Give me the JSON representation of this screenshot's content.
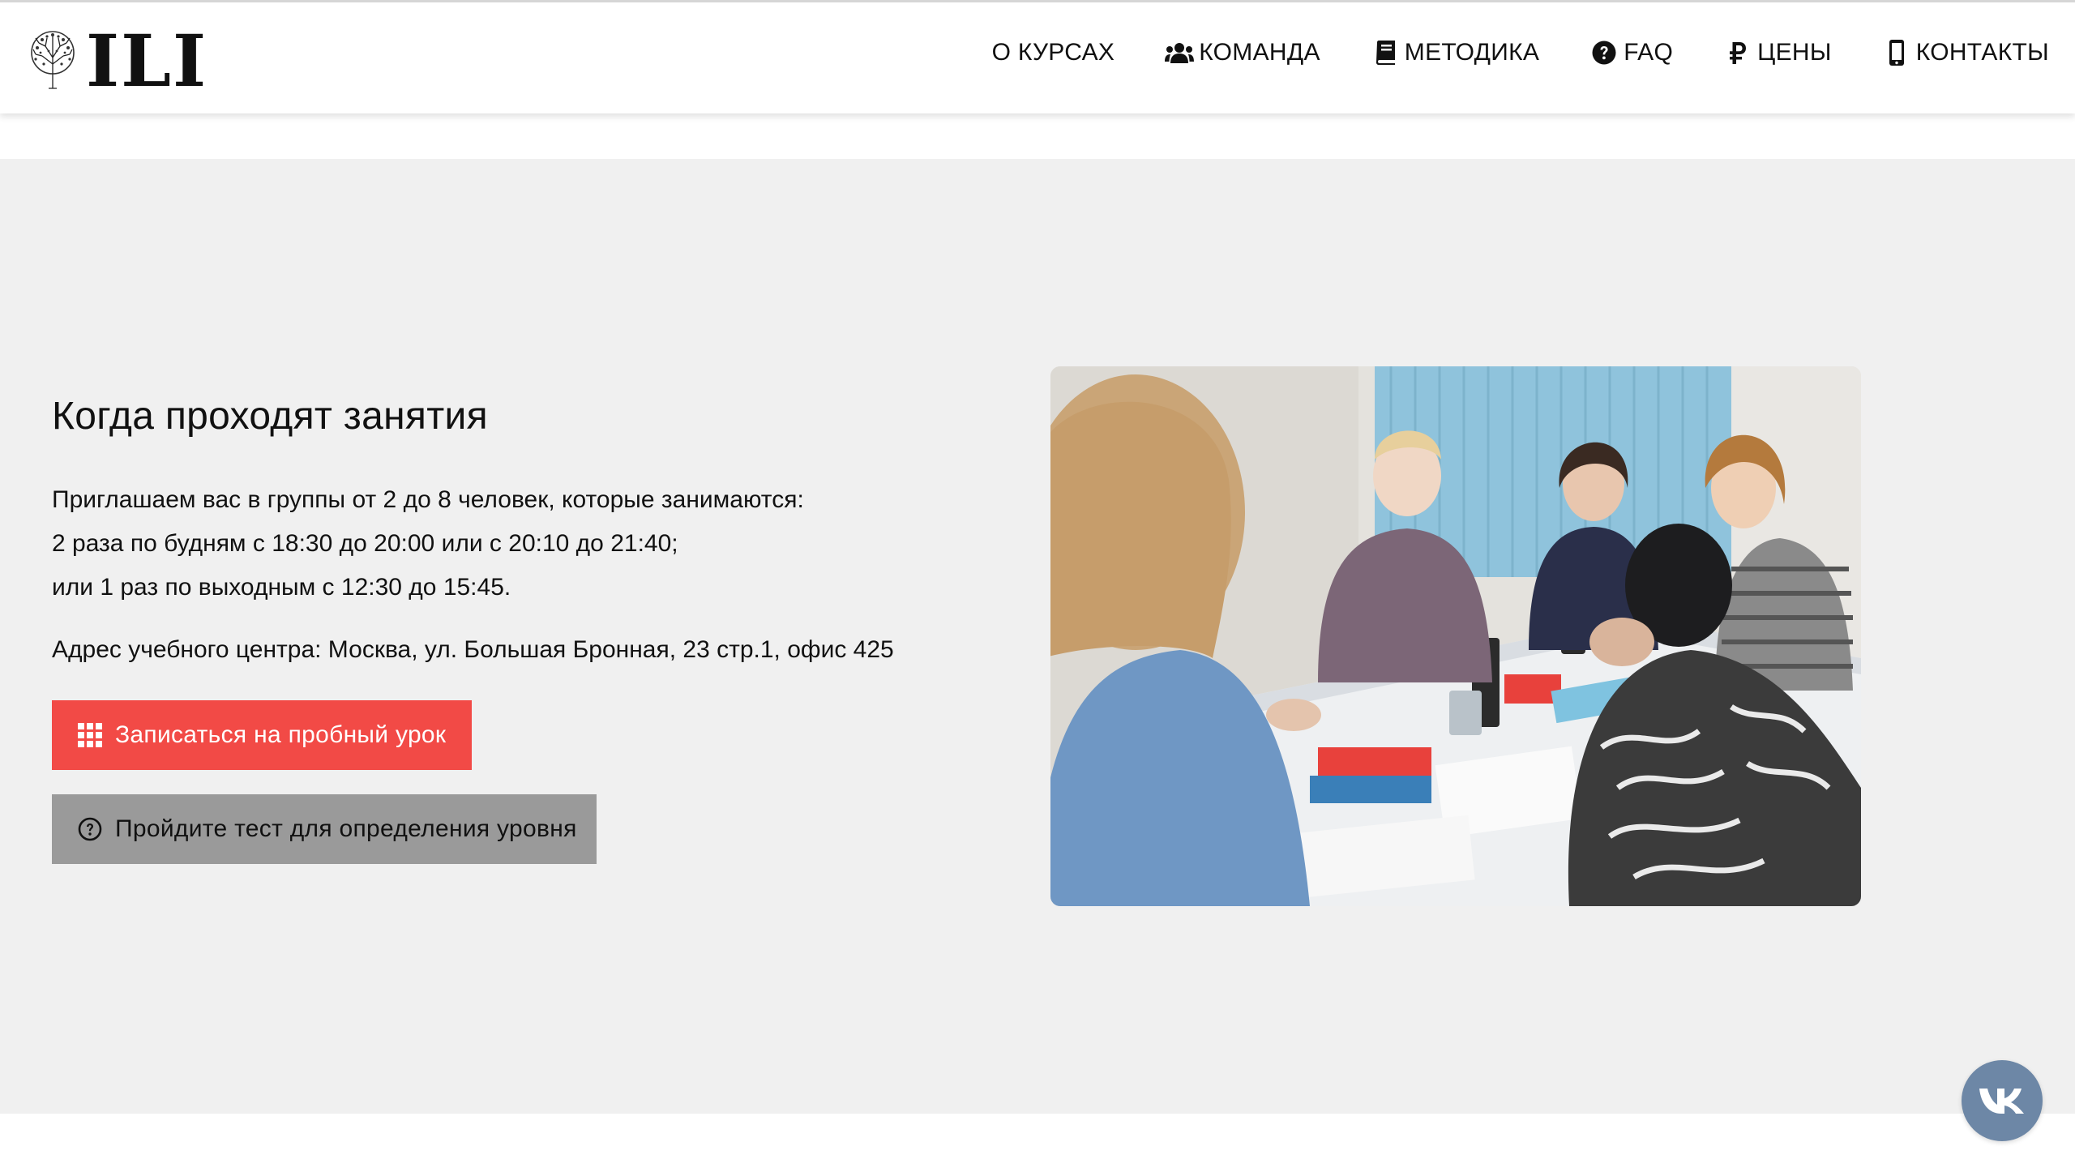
{
  "header": {
    "logo_text": "ILI",
    "nav": [
      {
        "label": "О КУРСАХ",
        "icon": "none"
      },
      {
        "label": "КОМАНДА",
        "icon": "users-icon"
      },
      {
        "label": "МЕТОДИКА",
        "icon": "book-icon"
      },
      {
        "label": "FAQ",
        "icon": "question-circle-icon"
      },
      {
        "label": "ЦЕНЫ",
        "icon": "ruble-icon"
      },
      {
        "label": "КОНТАКТЫ",
        "icon": "mobile-phone-icon"
      }
    ]
  },
  "main": {
    "title": "Когда проходят занятия",
    "lead_lines": [
      "Приглашаем вас в группы от 2 до 8 человек, которые занимаются:",
      "2 раза по будням с 18:30 до 20:00 или с 20:10 до 21:40;",
      "или 1 раз по выходным с 12:30 до 15:45."
    ],
    "address": "Адрес учебного центра: Москва, ул. Большая Бронная, 23 стр.1, офис 425",
    "primary_button": {
      "label": "Записаться на пробный урок",
      "icon": "grid-icon"
    },
    "secondary_button": {
      "label": "Пройдите тест для определения уровня",
      "icon": "question-circle-icon"
    },
    "photo": {
      "label": "group-lesson-photo"
    }
  },
  "floating": {
    "vk_label": "VK"
  },
  "colors": {
    "primary_button": "#f24a46",
    "secondary_button": "#9a9a9a",
    "section_bg": "#f0f0f0",
    "vk_button": "#6d87a6"
  }
}
